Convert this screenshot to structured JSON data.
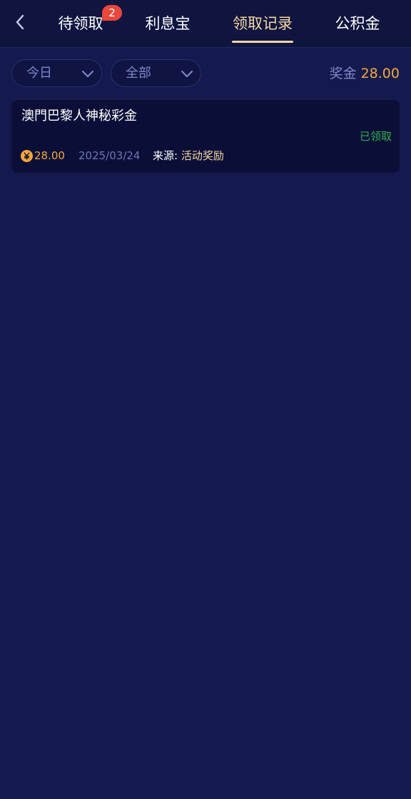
{
  "header": {
    "tabs": [
      {
        "label": "待领取",
        "badge": "2"
      },
      {
        "label": "利息宝"
      },
      {
        "label": "领取记录",
        "active": true
      },
      {
        "label": "公积金"
      }
    ]
  },
  "filters": {
    "date": "今日",
    "type": "全部"
  },
  "summary": {
    "label": "奖金",
    "amount": "28.00"
  },
  "records": [
    {
      "title": "澳門巴黎人神秘彩金",
      "status": "已领取",
      "amount": "28.00",
      "date": "2025/03/24",
      "source_label": "来源:",
      "source_value": "活动奖励"
    }
  ],
  "colors": {
    "background": "#141a4e",
    "header": "#10153f",
    "active_tab": "#f5d8a3",
    "amount": "#f4a93b",
    "status_claimed": "#2fb14a",
    "badge": "#e8473c"
  },
  "icons": {
    "back": "chevron-left-icon",
    "dropdown": "chevron-down-icon",
    "coin": "yuan-coin-icon"
  }
}
